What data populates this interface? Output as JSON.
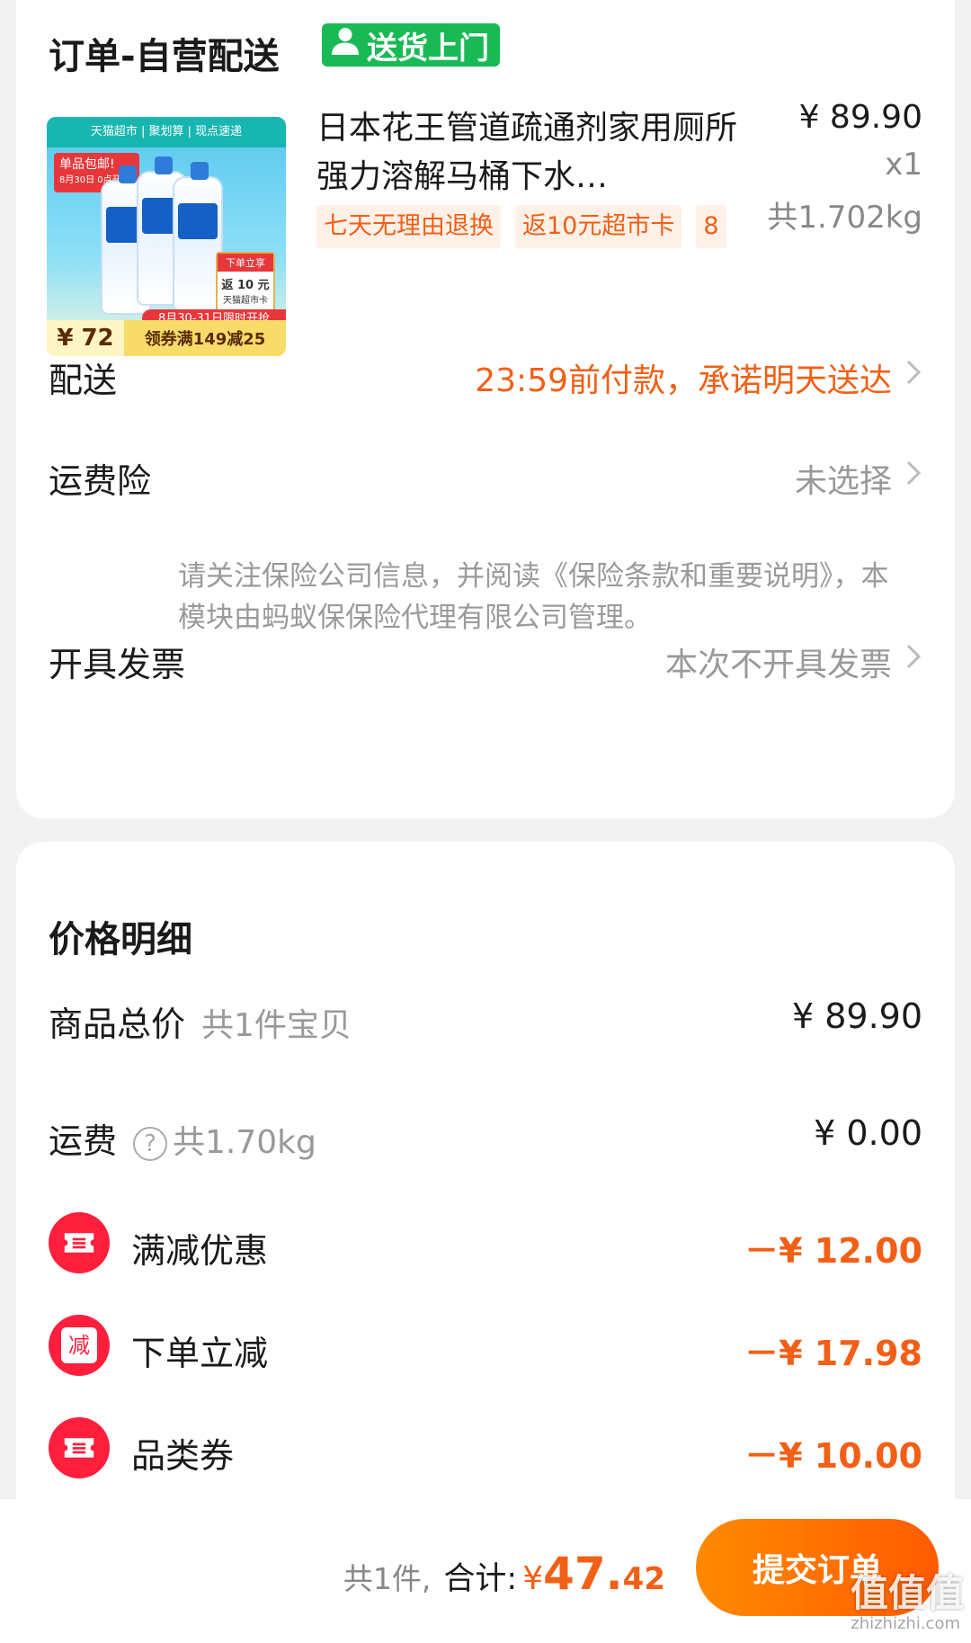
{
  "order": {
    "title": "订单-自营配送",
    "delivery_badge": "送货上门",
    "product": {
      "title": "日本花王管道疏通剂家用厕所强力溶解马桶下水…",
      "price": "¥ 89.90",
      "qty": "x1",
      "weight": "共1.702kg",
      "tags": [
        "七天无理由退换",
        "返10元超市卡",
        "8"
      ],
      "thumb": {
        "top_banner": "天猫超市 | 聚划算 | 现点速递",
        "free_shipping": "单品包邮!",
        "free_shipping_sub": "8月30日 0点开抢!",
        "rebate_top": "下单立享",
        "rebate_main": "返 10 元",
        "rebate_sub": "天猫超市卡",
        "sale_bar": "8月30-31日限时开抢",
        "price": "¥ 72",
        "coupon": "领券满149减25"
      }
    },
    "delivery": {
      "label": "配送",
      "value": "23:59前付款，承诺明天送达"
    },
    "insurance": {
      "label": "运费险",
      "value": "未选择",
      "note": "请关注保险公司信息，并阅读《保险条款和重要说明》，本模块由蚂蚁保保险代理有限公司管理。"
    },
    "invoice": {
      "label": "开具发票",
      "value": "本次不开具发票"
    }
  },
  "price_detail": {
    "title": "价格明细",
    "goods_total": {
      "label": "商品总价",
      "sub": "共1件宝贝",
      "value": "¥ 89.90"
    },
    "shipping": {
      "label": "运费",
      "help": "?",
      "sub": "共1.70kg",
      "value": "¥ 0.00"
    },
    "discounts": [
      {
        "label": "满减优惠",
        "value": "－¥ 12.00",
        "icon": "ticket-icon"
      },
      {
        "label": "下单立减",
        "value": "－¥ 17.98",
        "icon": "minus-badge-icon",
        "icon_text": "减"
      },
      {
        "label": "品类券",
        "value": "－¥ 10.00",
        "icon": "ticket-icon"
      }
    ]
  },
  "bottom_bar": {
    "count": "共1件,",
    "total_label": "合计:",
    "currency": "¥",
    "total_int": "47.",
    "total_dec": "42",
    "submit": "提交订单"
  },
  "watermark": {
    "main": "值值值",
    "sub": "zhizhizhi.com"
  },
  "colors": {
    "accent": "#f25f16",
    "badge_green": "#19b955",
    "discount_red": "#ff1f3d",
    "button": "#ff6a00"
  }
}
